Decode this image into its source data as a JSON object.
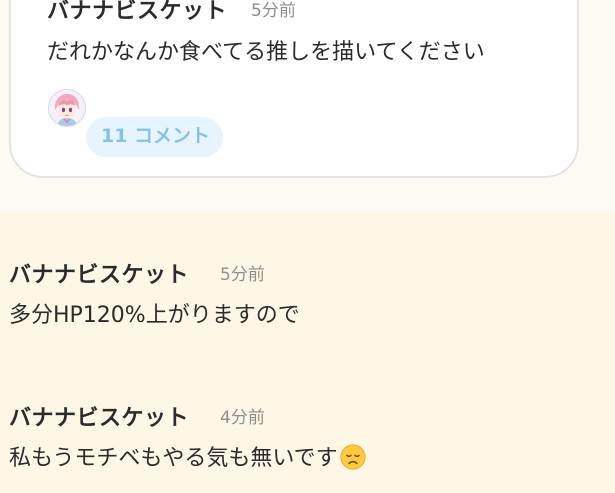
{
  "post": {
    "author": "バナナビスケット",
    "time": "5分前",
    "body": "だれかなんか食べてる推しを描いてください",
    "comment_count_label": "11 コメント",
    "avatar_icon": "anime-avatar-icon"
  },
  "replies": [
    {
      "author": "バナナビスケット",
      "time": "5分前",
      "text": "多分HP120%上がりますので"
    },
    {
      "author": "バナナビスケット",
      "time": "4分前",
      "text": "私もうモチベもやる気も無いです",
      "emoji": "disappointed-face-icon"
    }
  ],
  "colors": {
    "top_background": "#fdfaf4",
    "reply_background": "#fff7e6",
    "comment_pill_bg": "#e7f4fd",
    "comment_pill_text": "#84c2ec",
    "timestamp": "#8e8e8e"
  }
}
